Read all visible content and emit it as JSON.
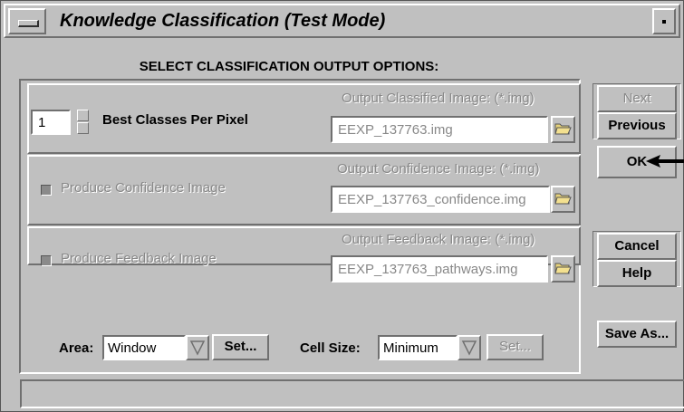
{
  "window": {
    "title": "Knowledge Classification (Test Mode)"
  },
  "heading": "SELECT CLASSIFICATION OUTPUT OPTIONS:",
  "classified": {
    "best_classes_value": "1",
    "best_classes_label": "Best Classes Per Pixel",
    "output_label": "Output Classified Image: (*.img)",
    "output_value": "EEXP_137763.img"
  },
  "confidence": {
    "checkbox_label": "Produce Confidence Image",
    "output_label": "Output Confidence Image: (*.img)",
    "output_value": "EEXP_137763_confidence.img"
  },
  "feedback": {
    "checkbox_label": "Produce Feedback Image",
    "output_label": "Output Feedback Image: (*.img)",
    "output_value": "EEXP_137763_pathways.img"
  },
  "bottom": {
    "area_label": "Area:",
    "area_value": "Window",
    "area_set": "Set...",
    "cell_label": "Cell Size:",
    "cell_value": "Minimum",
    "cell_set": "Set..."
  },
  "buttons": {
    "next": "Next",
    "previous": "Previous",
    "ok": "OK",
    "cancel": "Cancel",
    "help": "Help",
    "save_as": "Save As..."
  },
  "colors": {
    "panel": "#c0c0c0",
    "disabled_text": "#888888",
    "arrow": "#000000"
  }
}
